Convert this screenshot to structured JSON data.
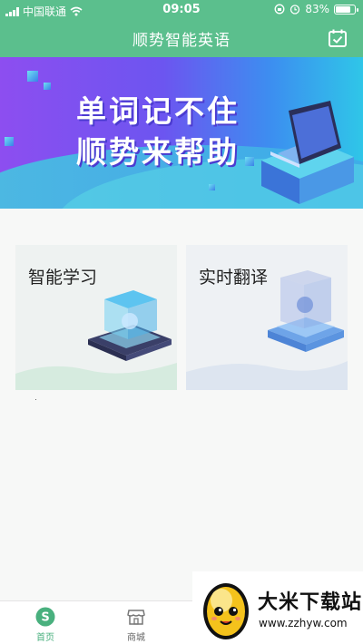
{
  "status_bar": {
    "carrier": "中国联通",
    "time": "09:05",
    "battery_percent": "83%",
    "battery_level": 0.83,
    "icons": [
      "signal-icon",
      "wifi-icon",
      "lock-rotation-icon",
      "alarm-icon",
      "battery-icon"
    ]
  },
  "header": {
    "title": "顺势智能英语",
    "action_icon": "calendar-check-icon"
  },
  "banner": {
    "line1": "单词记不住",
    "line2": "顺势来帮助"
  },
  "cards": [
    {
      "title": "智能学习"
    },
    {
      "title": "实时翻译"
    }
  ],
  "tabbar": {
    "items": [
      {
        "label": "首页",
        "icon": "home-s-icon",
        "active": true
      },
      {
        "label": "商城",
        "icon": "shop-icon",
        "active": false
      }
    ]
  },
  "watermark": {
    "name": "大米下载站",
    "url": "www.zzhyw.com"
  },
  "colors": {
    "brand_green": "#5bbf8d",
    "active_tab": "#49b07e",
    "banner_purple": "#8d4ef0",
    "banner_cyan": "#2fc6e8"
  }
}
